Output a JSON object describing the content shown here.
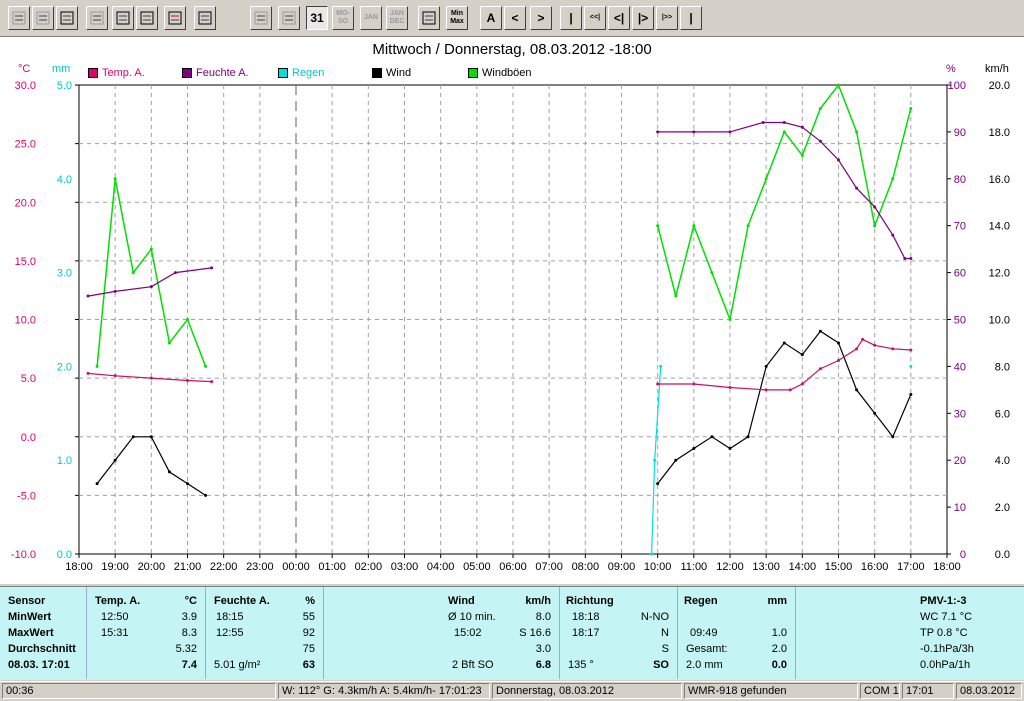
{
  "toolbar": {
    "buttons": [
      {
        "name": "open-icon",
        "label": ""
      },
      {
        "name": "save-icon",
        "label": ""
      },
      {
        "name": "save-as-icon",
        "label": ""
      },
      {
        "name": "table-icon",
        "label": ""
      },
      {
        "name": "notes-icon",
        "label": ""
      },
      {
        "name": "print-icon",
        "label": ""
      },
      {
        "name": "graph-icon",
        "label": ""
      },
      {
        "name": "graph-window-icon",
        "label": ""
      },
      {
        "name": "timeline-icon",
        "label": ""
      },
      {
        "name": "target-icon",
        "label": ""
      },
      {
        "name": "day-view-icon",
        "label": "31"
      },
      {
        "name": "week-view-icon",
        "label": "MO-SO"
      },
      {
        "name": "month-view-icon",
        "label": "JAN"
      },
      {
        "name": "year-view-icon",
        "label": "JAN DEC"
      },
      {
        "name": "list-icon",
        "label": ""
      },
      {
        "name": "minmax-icon",
        "label": "Min Max"
      },
      {
        "name": "auto-button",
        "label": "A"
      },
      {
        "name": "prev-button",
        "label": "<"
      },
      {
        "name": "next-button",
        "label": ">"
      },
      {
        "name": "first-button",
        "label": "|"
      },
      {
        "name": "rewind-fast-button",
        "label": "<<|"
      },
      {
        "name": "rewind-button",
        "label": "<|"
      },
      {
        "name": "forward-button",
        "label": "|>"
      },
      {
        "name": "forward-fast-button",
        "label": "|>>"
      },
      {
        "name": "last-button",
        "label": "|"
      }
    ]
  },
  "chart": {
    "title": "Mittwoch / Donnerstag, 08.03.2012  -18:00",
    "unit_temp": "°C",
    "unit_rain": "mm",
    "unit_hum": "%",
    "unit_wind": "km/h",
    "legend": [
      {
        "label": "Temp. A.",
        "color": "#e0006a"
      },
      {
        "label": "Feuchte A.",
        "color": "#800080"
      },
      {
        "label": "Regen",
        "color": "#00e0e0"
      },
      {
        "label": "Wind",
        "color": "#000000"
      },
      {
        "label": "Windböen",
        "color": "#00e000"
      }
    ],
    "temp_ticks": [
      "30.0",
      "25.0",
      "20.0",
      "15.0",
      "10.0",
      "5.0",
      "0.0",
      "-5.0",
      "-10.0"
    ],
    "rain_ticks": [
      "5.0",
      "4.0",
      "3.0",
      "2.0",
      "1.0",
      "0.0"
    ],
    "hum_ticks": [
      "100",
      "90",
      "80",
      "70",
      "60",
      "50",
      "40",
      "30",
      "20",
      "10",
      "0"
    ],
    "wind_ticks": [
      "20.0",
      "18.0",
      "16.0",
      "14.0",
      "12.0",
      "10.0",
      "8.0",
      "6.0",
      "4.0",
      "2.0",
      "0.0"
    ],
    "x_ticks": [
      "18:00",
      "19:00",
      "20:00",
      "21:00",
      "22:00",
      "23:00",
      "00:00",
      "01:00",
      "02:00",
      "03:00",
      "04:00",
      "05:00",
      "06:00",
      "07:00",
      "08:00",
      "09:00",
      "10:00",
      "11:00",
      "12:00",
      "13:00",
      "14:00",
      "15:00",
      "16:00",
      "17:00",
      "18:00"
    ]
  },
  "chart_data": {
    "type": "line",
    "x_range": [
      "18:00",
      "18:00"
    ],
    "axes": {
      "temp": {
        "unit": "°C",
        "range": [
          -10,
          30
        ]
      },
      "rain": {
        "unit": "mm",
        "range": [
          0,
          5
        ]
      },
      "humidity": {
        "unit": "%",
        "range": [
          0,
          100
        ]
      },
      "wind": {
        "unit": "km/h",
        "range": [
          0,
          20
        ]
      }
    },
    "series": [
      {
        "name": "Temp. A.",
        "axis": "temp",
        "points": [
          [
            "18:15",
            5.4
          ],
          [
            "19:00",
            5.2
          ],
          [
            "20:00",
            5.0
          ],
          [
            "21:00",
            4.8
          ],
          [
            "21:40",
            4.7
          ],
          [
            "10:00",
            4.5
          ],
          [
            "11:00",
            4.5
          ],
          [
            "12:00",
            4.2
          ],
          [
            "13:00",
            4.0
          ],
          [
            "13:40",
            4.0
          ],
          [
            "14:00",
            4.5
          ],
          [
            "14:30",
            5.8
          ],
          [
            "15:00",
            6.5
          ],
          [
            "15:30",
            7.5
          ],
          [
            "15:40",
            8.3
          ],
          [
            "16:00",
            7.8
          ],
          [
            "16:30",
            7.5
          ],
          [
            "17:00",
            7.4
          ]
        ]
      },
      {
        "name": "Feuchte A.",
        "axis": "humidity",
        "points": [
          [
            "18:15",
            55
          ],
          [
            "19:00",
            56
          ],
          [
            "20:00",
            57
          ],
          [
            "20:40",
            60
          ],
          [
            "21:40",
            61
          ],
          [
            "10:00",
            90
          ],
          [
            "11:00",
            90
          ],
          [
            "12:00",
            90
          ],
          [
            "12:55",
            92
          ],
          [
            "13:30",
            92
          ],
          [
            "14:00",
            91
          ],
          [
            "14:30",
            88
          ],
          [
            "15:00",
            84
          ],
          [
            "15:30",
            78
          ],
          [
            "16:00",
            74
          ],
          [
            "16:30",
            68
          ],
          [
            "16:50",
            63
          ],
          [
            "17:00",
            63
          ]
        ]
      },
      {
        "name": "Regen",
        "axis": "rain",
        "points": [
          [
            "09:50",
            0.0
          ],
          [
            "09:55",
            1.0
          ],
          [
            "10:05",
            2.0
          ],
          [
            "17:00",
            2.0
          ]
        ]
      },
      {
        "name": "Wind",
        "axis": "wind",
        "points": [
          [
            "18:30",
            3.0
          ],
          [
            "19:00",
            4.0
          ],
          [
            "19:30",
            5.0
          ],
          [
            "20:00",
            5.0
          ],
          [
            "20:30",
            3.5
          ],
          [
            "21:00",
            3.0
          ],
          [
            "21:30",
            2.5
          ],
          [
            "10:00",
            3.0
          ],
          [
            "10:30",
            4.0
          ],
          [
            "11:00",
            4.5
          ],
          [
            "11:30",
            5.0
          ],
          [
            "12:00",
            4.5
          ],
          [
            "12:30",
            5.0
          ],
          [
            "13:00",
            8.0
          ],
          [
            "13:30",
            9.0
          ],
          [
            "14:00",
            8.5
          ],
          [
            "14:30",
            9.5
          ],
          [
            "15:00",
            9.0
          ],
          [
            "15:30",
            7.0
          ],
          [
            "16:00",
            6.0
          ],
          [
            "16:30",
            5.0
          ],
          [
            "17:00",
            6.8
          ]
        ]
      },
      {
        "name": "Windböen",
        "axis": "wind",
        "points": [
          [
            "18:30",
            8.0
          ],
          [
            "19:00",
            16.0
          ],
          [
            "19:30",
            12.0
          ],
          [
            "20:00",
            13.0
          ],
          [
            "20:30",
            9.0
          ],
          [
            "21:00",
            10.0
          ],
          [
            "21:30",
            8.0
          ],
          [
            "10:00",
            14.0
          ],
          [
            "10:30",
            11.0
          ],
          [
            "11:00",
            14.0
          ],
          [
            "11:30",
            12.0
          ],
          [
            "12:00",
            10.0
          ],
          [
            "12:30",
            14.0
          ],
          [
            "13:00",
            16.0
          ],
          [
            "13:30",
            18.0
          ],
          [
            "14:00",
            17.0
          ],
          [
            "14:30",
            19.0
          ],
          [
            "15:00",
            20.0
          ],
          [
            "15:30",
            18.0
          ],
          [
            "16:00",
            14.0
          ],
          [
            "16:30",
            16.0
          ],
          [
            "17:00",
            19.0
          ]
        ]
      }
    ]
  },
  "panel": {
    "sensor": {
      "h": "Sensor",
      "r1": "MinWert",
      "r2": "MaxWert",
      "r3": "Durchschnitt",
      "r4": "08.03. 17:01"
    },
    "temp": {
      "h": "Temp. A.",
      "u": "°C",
      "min_t": "12:50",
      "min": "3.9",
      "max_t": "15:31",
      "max": "8.3",
      "avg": "5.32",
      "cur": "7.4"
    },
    "hum": {
      "h": "Feuchte A.",
      "u": "%",
      "min_t": "18:15",
      "min": "55",
      "max_t": "12:55",
      "max": "92",
      "avg": "75",
      "abs": "5.01 g/m²",
      "cur": "63"
    },
    "wind": {
      "h": "Wind",
      "u": "km/h",
      "r1a": "Ø 10 min.",
      "r1b": "8.0",
      "r2a": "15:02",
      "r2b": "S 16.6",
      "r3b": "3.0",
      "r4a": "2 Bft SO",
      "r4b": "6.8"
    },
    "dir": {
      "h": "Richtung",
      "r1a": "18:18",
      "r1b": "N-NO",
      "r2a": "18:17",
      "r2b": "N",
      "r3b": "S",
      "r4a": "135 °",
      "r4b": "SO"
    },
    "rain": {
      "h": "Regen",
      "u": "mm",
      "r2a": "09:49",
      "r2b": "1.0",
      "r3a": "Gesamt:",
      "r3b": "2.0",
      "r4a": "2.0 mm",
      "r4b": "0.0"
    },
    "pmv": {
      "h": "PMV-1:-3",
      "r1": "WC 7.1 °C",
      "r2": "TP 0.8 °C",
      "r3": "-0.1hPa/3h",
      "r4": "0.0hPa/1h"
    }
  },
  "status": {
    "time": "00:36",
    "wind": "W: 112°  G: 4.3km/h  A: 5.4km/h- 17:01:23",
    "date": "Donnerstag, 08.03.2012",
    "station": "WMR-918  gefunden",
    "port": "COM 1",
    "clock": "17:01",
    "today": "08.03.2012"
  }
}
